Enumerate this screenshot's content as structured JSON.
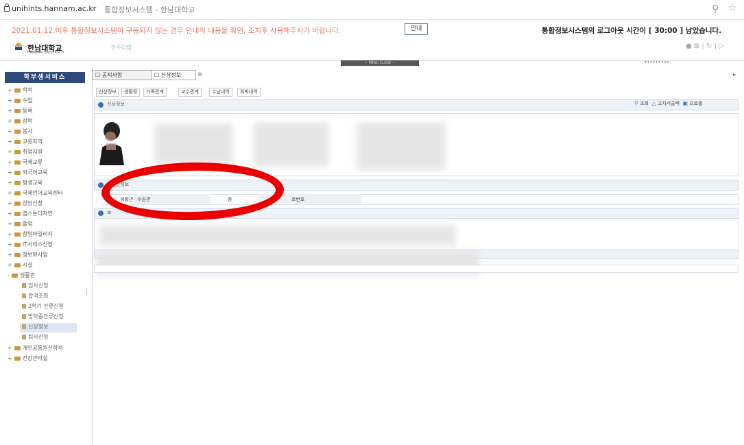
{
  "browser": {
    "host": "unihints.hannam.ac.kr",
    "title": "통합정보시스템 - 한남대학교",
    "zoom_icon": "zoom-icon",
    "star_icon": "star-icon"
  },
  "header": {
    "notice": "2021.01.12.이후 통합정보시스템이 구동되지 않는 경우 안내의 내용을 확인, 조치후 사용해주시기 바랍니다.",
    "notice_button": "안내",
    "logout": "통합정보시스템의 로그아웃 시간이 [ 30:00 ] 남았습니다.",
    "logo_name": "한남대학교",
    "logo_sub": "HANNAM UNIVERSITY",
    "top_menu": "안주리캠",
    "util_icons": "● ⊠ | ↻ | ▷",
    "center_tab": "~ MENU CLOSE ~",
    "right_links": "▾ ▾ ▾ ▾ ▾ ▾ ▾ ▾ ▾"
  },
  "sidebar": {
    "title": "학부생서비스",
    "items": [
      "학적",
      "수업",
      "등록",
      "장학",
      "봉사",
      "교원자격",
      "취업지원",
      "국제교류",
      "외국어교육",
      "평생교육",
      "국제언어교육센터",
      "상담신청",
      "캡스톤디자인",
      "졸업",
      "창업마일리지",
      "IT서비스신청",
      "정보화사업",
      "시설",
      "생활관"
    ],
    "subitems": [
      "입사신청",
      "합격조회",
      "2학기 잔류신청",
      "방학중잔류신청",
      "신상정보",
      "퇴사신청"
    ],
    "items_after": [
      "개인공통원신학적",
      "건강관리실"
    ]
  },
  "page_tabs": [
    "공지사항",
    "신상정보"
  ],
  "page_tab_close": "≡",
  "content_arrow": "▸",
  "sub_tabs": [
    "신상정보",
    "생활정",
    "가족관계",
    "교수관계",
    "수납내역",
    "외박내역"
  ],
  "panels": {
    "info_title": "신상정보",
    "actions": [
      "조회",
      "고지서출력",
      "프로필"
    ],
    "section2_title": "생활관정보",
    "section3_title": "보"
  },
  "fields": {
    "label1": "생활관",
    "value1": "수원관",
    "value2": "층",
    "label3": "호번호"
  }
}
